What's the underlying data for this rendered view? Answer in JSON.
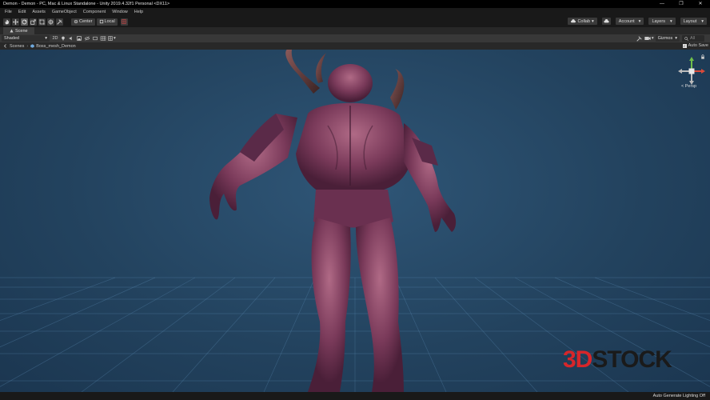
{
  "window": {
    "title": "Demon - Demon - PC, Mac & Linux Standalone - Unity 2019.4.32f1 Personal <DX11>",
    "controls": {
      "minimize": "—",
      "maximize": "❐",
      "close": "✕"
    }
  },
  "menu": {
    "items": [
      "File",
      "Edit",
      "Assets",
      "GameObject",
      "Component",
      "Window",
      "Help"
    ]
  },
  "toolbar": {
    "tools": [
      "hand-tool",
      "move-tool",
      "rotate-tool",
      "scale-tool",
      "rect-tool",
      "transform-tool",
      "custom-tool"
    ],
    "pivot_label": "Center",
    "space_label": "Local",
    "play": "▶",
    "pause": "❚❚",
    "step": "▶❚",
    "collab_label": "Collab",
    "account_label": "Account",
    "layers_label": "Layers",
    "layout_label": "Layout",
    "dropdown_arrow": "▾"
  },
  "scene_tab": {
    "label": "Scene"
  },
  "scene_options": {
    "shading_label": "Shaded",
    "mode_2d_label": "2D",
    "gizmos_label": "Gizmos",
    "search_all": "All"
  },
  "breadcrumb": {
    "root_label": "Scenes",
    "separator": "›",
    "current_label": "Boss_mesh_Demon",
    "auto_save_label": "Auto Save"
  },
  "viewport": {
    "persp_label": "< Persp"
  },
  "watermark": {
    "part1": "3D",
    "part2": "STOCK"
  },
  "status": {
    "text": "Auto Generate Lighting Off"
  },
  "colors": {
    "accent": "#d7262a",
    "sky": "#2a4d6c",
    "grid": "#5f8fb8"
  }
}
